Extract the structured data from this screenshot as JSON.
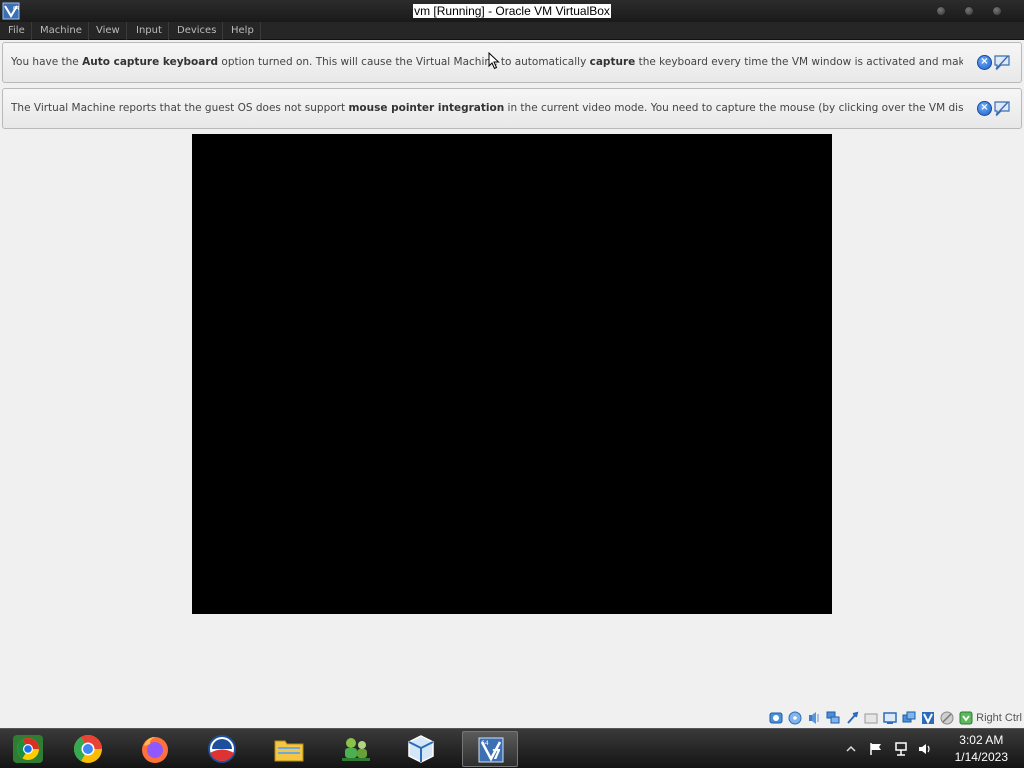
{
  "window": {
    "title": "vm [Running] - Oracle VM VirtualBox"
  },
  "menu": {
    "items": [
      "File",
      "Machine",
      "View",
      "Input",
      "Devices",
      "Help"
    ]
  },
  "notifications": [
    {
      "pre": "You have the ",
      "bold1": "Auto capture keyboard",
      "mid": " option turned on. This will cause the Virtual Machine to automatically ",
      "bold2": "capture",
      "post": " the keyboard every time the VM window is activated and make it unavailable to"
    },
    {
      "pre": "The Virtual Machine reports that the guest OS does not support ",
      "bold1": "mouse pointer integration",
      "mid": " in the current video mode. You need to capture the mouse (by clicking over the VM display or pressing",
      "bold2": "",
      "post": ""
    }
  ],
  "statusbar": {
    "host_key": "Right Ctrl",
    "icons": [
      "hard-disk-icon",
      "optical-drive-icon",
      "audio-icon",
      "network-icon",
      "usb-icon",
      "shared-folders-icon",
      "display-icon",
      "video-capture-icon",
      "virtualization-icon",
      "mouse-integration-icon",
      "keyboard-capture-icon"
    ]
  },
  "taskbar": {
    "apps": [
      "chromium-icon",
      "chrome-icon",
      "firefox-icon",
      "obama-logo-icon",
      "file-manager-icon",
      "network-users-icon",
      "virtualbox-icon",
      "windows7-vm-icon"
    ],
    "clock": {
      "time": "3:02 AM",
      "date": "1/14/2023"
    }
  },
  "colors": {
    "titlebar": "#1a1a1a",
    "menubar": "#262626",
    "notice_bg": "#eeeeee",
    "vm_screen": "#000000",
    "taskbar": "#1c1c1c"
  }
}
